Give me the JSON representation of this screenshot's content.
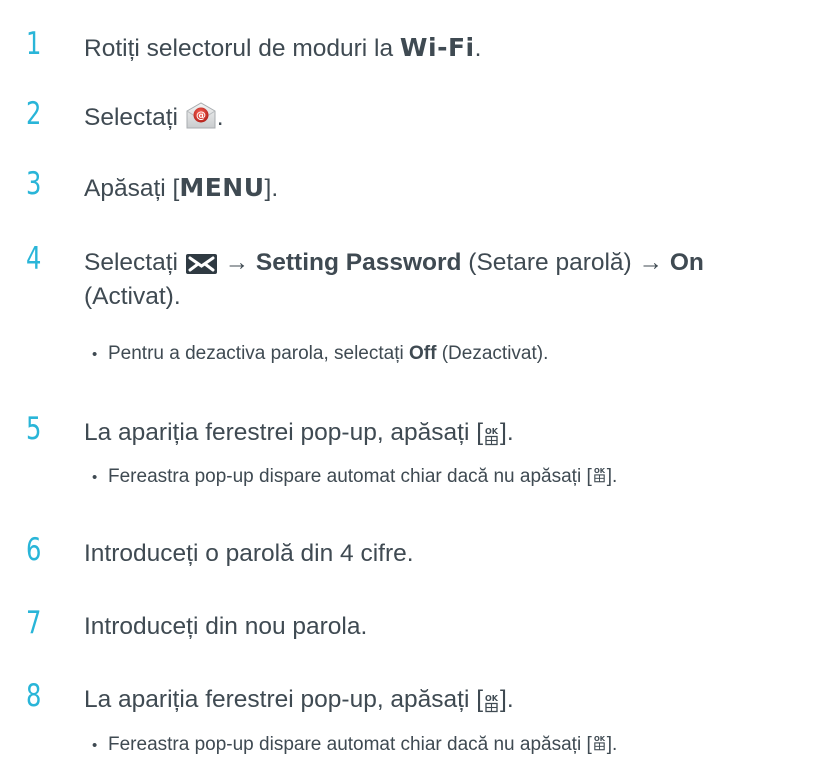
{
  "steps": [
    {
      "num": "1",
      "pre": "Rotiți selectorul de moduri la ",
      "mode": "Wi-Fi",
      "post": "."
    },
    {
      "num": "2",
      "pre": "Selectați ",
      "icon": "email-app-icon",
      "post": "."
    },
    {
      "num": "3",
      "pre": "Apăsați [",
      "key": "MENU",
      "post": "]."
    },
    {
      "num": "4",
      "pre": "Selectați ",
      "icon": "envelope-icon",
      "arrow1": " → ",
      "bold1": "Setting Password",
      "mid": " (Setare parolă) ",
      "arrow2": "→ ",
      "bold2": "On",
      "line2": "(Activat).",
      "bullet": {
        "pre": "Pentru a dezactiva parola, selectați ",
        "bold": "Off",
        "post": " (Dezactivat)."
      }
    },
    {
      "num": "5",
      "pre": "La apariția ferestrei pop-up, apăsați [",
      "icon": "ok-button-icon",
      "post": "].",
      "bullet": {
        "pre": "Fereastra pop-up dispare automat chiar dacă nu apăsați [",
        "icon": "ok-button-icon",
        "post": "]."
      }
    },
    {
      "num": "6",
      "text": "Introduceți o parolă din 4 cifre."
    },
    {
      "num": "7",
      "text": "Introduceți din nou parola."
    },
    {
      "num": "8",
      "pre": "La apariția ferestrei pop-up, apăsați [",
      "icon": "ok-button-icon",
      "post": "].",
      "bullet": {
        "pre": "Fereastra pop-up dispare automat chiar dacă nu apăsați [",
        "icon": "ok-button-icon",
        "post": "]."
      }
    }
  ],
  "colors": {
    "step_number": "#29b5d8",
    "text": "#3f4a52",
    "email_icon": "#d9362b",
    "envelope_icon": "#2f3a42"
  }
}
